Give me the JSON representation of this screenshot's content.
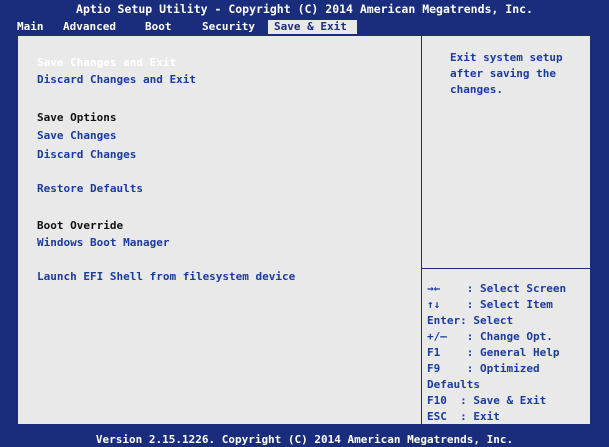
{
  "title": "Aptio Setup Utility - Copyright (C) 2014 American Megatrends, Inc.",
  "tabs": [
    "Main",
    "Advanced",
    "Boot",
    "Security",
    "Save & Exit"
  ],
  "active_tab": "Save & Exit",
  "menu": {
    "save_changes_and_exit": "Save Changes and Exit",
    "discard_changes_and_exit": "Discard Changes and Exit",
    "save_options_header": "Save Options",
    "save_changes": "Save Changes",
    "discard_changes": "Discard Changes",
    "restore_defaults": "Restore Defaults",
    "boot_override_header": "Boot Override",
    "windows_boot_manager": "Windows Boot Manager",
    "launch_efi_shell": "Launch EFI Shell from filesystem device"
  },
  "help_text": "Exit system setup\nafter saving the\nchanges.",
  "keys": [
    "→←    : Select Screen",
    "↑↓    : Select Item",
    "Enter: Select",
    "+/—   : Change Opt.",
    "F1    : General Help",
    "F9    : Optimized",
    "Defaults",
    "F10  : Save & Exit",
    "ESC  : Exit"
  ],
  "footer": "Version 2.15.1226. Copyright (C) 2014 American Megatrends, Inc."
}
